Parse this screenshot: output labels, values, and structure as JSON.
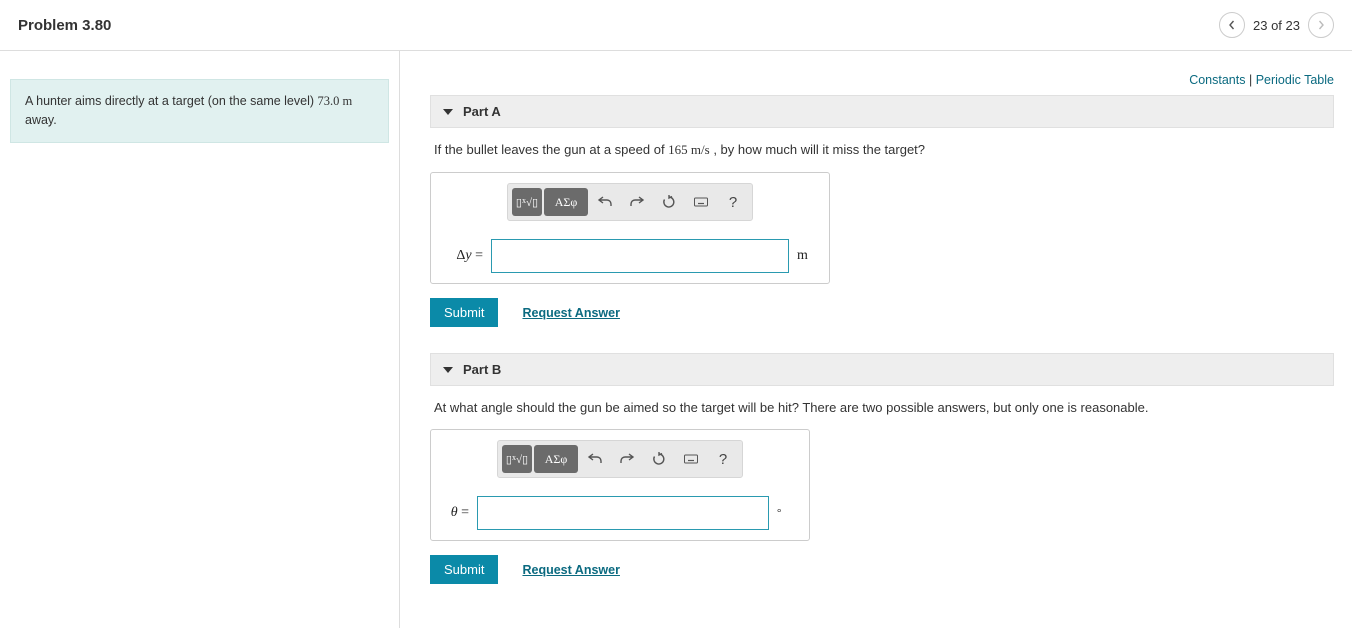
{
  "header": {
    "title": "Problem 3.80",
    "pager_text": "23 of 23"
  },
  "top_links": {
    "constants": "Constants",
    "periodic": "Periodic Table"
  },
  "prompt": {
    "text_pre": "A hunter aims directly at a target (on the same level) ",
    "distance": "73.0 m",
    "text_post": " away."
  },
  "parts": [
    {
      "label": "Part A",
      "question_pre": "If the bullet leaves the gun at a speed of ",
      "speed": "165 m/s",
      "question_post": " , by how much will it miss the target?",
      "lhs": "Δy =",
      "unit": "m",
      "submit": "Submit",
      "request": "Request Answer"
    },
    {
      "label": "Part B",
      "question": "At what angle should the gun be aimed so the target will be hit? There are two possible answers, but only one is reasonable.",
      "lhs": "θ =",
      "unit": "°",
      "submit": "Submit",
      "request": "Request Answer"
    }
  ],
  "toolbar": {
    "templates": "√x",
    "greek": "ΑΣφ",
    "help": "?"
  }
}
